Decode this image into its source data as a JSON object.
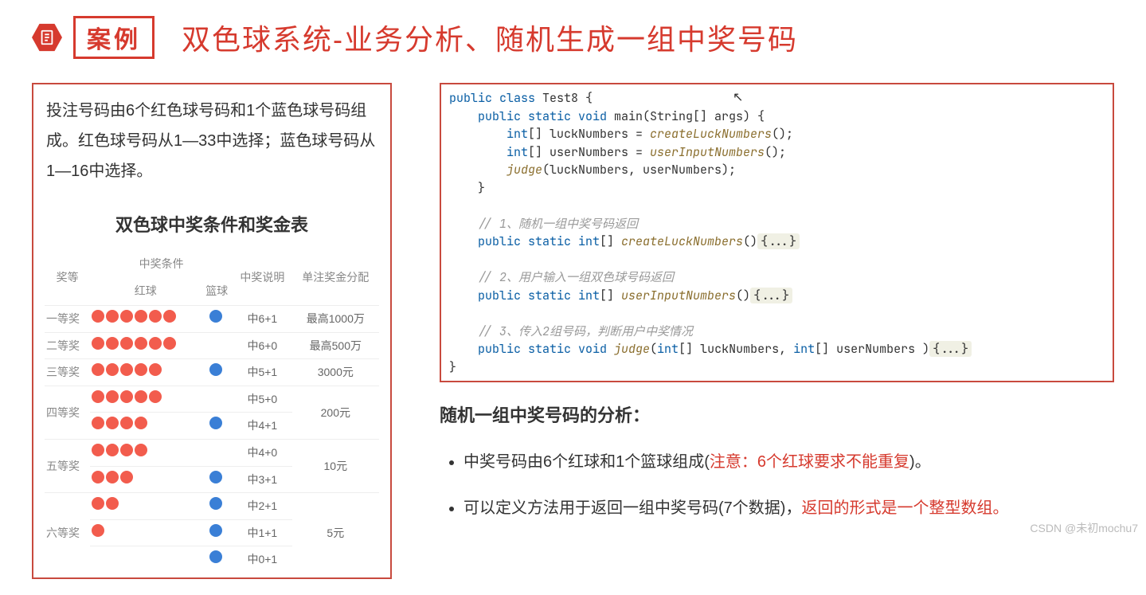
{
  "header": {
    "tag": "案例",
    "title": "双色球系统-业务分析、随机生成一组中奖号码"
  },
  "left": {
    "intro": "投注号码由6个红色球号码和1个蓝色球号码组成。红色球号码从1—33中选择；蓝色球号码从1—16中选择。",
    "table_title": "双色球中奖条件和奖金表",
    "columns": {
      "level": "奖等",
      "cond": "中奖条件",
      "red": "红球",
      "blue": "篮球",
      "desc": "中奖说明",
      "payout": "单注奖金分配"
    },
    "rows": [
      {
        "level": "一等奖",
        "red": 6,
        "blue": 1,
        "desc": "中6+1",
        "payout": "最高1000万"
      },
      {
        "level": "二等奖",
        "red": 6,
        "blue": 0,
        "desc": "中6+0",
        "payout": "最高500万"
      },
      {
        "level": "三等奖",
        "red": 5,
        "blue": 1,
        "desc": "中5+1",
        "payout": "3000元"
      },
      {
        "level": "",
        "red": 5,
        "blue": 0,
        "desc": "中5+0",
        "payout": ""
      },
      {
        "level": "四等奖",
        "red": 4,
        "blue": 1,
        "desc": "中4+1",
        "payout": "200元"
      },
      {
        "level": "",
        "red": 4,
        "blue": 0,
        "desc": "中4+0",
        "payout": ""
      },
      {
        "level": "五等奖",
        "red": 3,
        "blue": 1,
        "desc": "中3+1",
        "payout": "10元"
      },
      {
        "level": "",
        "red": 2,
        "blue": 1,
        "desc": "中2+1",
        "payout": ""
      },
      {
        "level": "六等奖",
        "red": 1,
        "blue": 1,
        "desc": "中1+1",
        "payout": "5元"
      },
      {
        "level": "",
        "red": 0,
        "blue": 1,
        "desc": "中0+1",
        "payout": ""
      }
    ],
    "merges": {
      "3": {
        "level": "四等奖",
        "payout": "200元"
      },
      "5": {
        "level": "五等奖",
        "payout": "10元"
      },
      "7": {
        "level": "六等奖",
        "payout": "5元"
      }
    }
  },
  "code": {
    "l1a": "public class",
    "l1b": " Test8 {",
    "l2a": "    public static void",
    "l2b": " main(String[] args) {",
    "l3a": "        int",
    "l3b": "[] luckNumbers = ",
    "l3c": "createLuckNumbers",
    "l3d": "();",
    "l4a": "        int",
    "l4b": "[] userNumbers = ",
    "l4c": "userInputNumbers",
    "l4d": "();",
    "l5a": "        ",
    "l5b": "judge",
    "l5c": "(luckNumbers, userNumbers);",
    "l6": "    }",
    "blank": "",
    "c1": "    // 1、随机一组中奖号码返回",
    "l7a": "    public static int",
    "l7b": "[] ",
    "l7c": "createLuckNumbers",
    "l7d": "()",
    "l7e": "{...}",
    "c2": "    // 2、用户输入一组双色球号码返回",
    "l8a": "    public static int",
    "l8b": "[] ",
    "l8c": "userInputNumbers",
    "l8d": "()",
    "l8e": "{...}",
    "c3": "    // 3、传入2组号码，判断用户中奖情况",
    "l9a": "    public static void ",
    "l9b": "judge",
    "l9c": "(",
    "l9d": "int",
    "l9e": "[] luckNumbers, ",
    "l9f": "int",
    "l9g": "[] userNumbers )",
    "l9h": "{...}",
    "l10": "}"
  },
  "analysis": {
    "title": "随机一组中奖号码的分析：",
    "b1a": "中奖号码由6个红球和1个篮球组成(",
    "b1b": "注意：6个红球要求不能重复",
    "b1c": ")。",
    "b2a": "可以定义方法用于返回一组中奖号码(7个数据)，",
    "b2b": "返回的形式是一个整型数组。"
  },
  "watermark": "CSDN @未初mochu7"
}
